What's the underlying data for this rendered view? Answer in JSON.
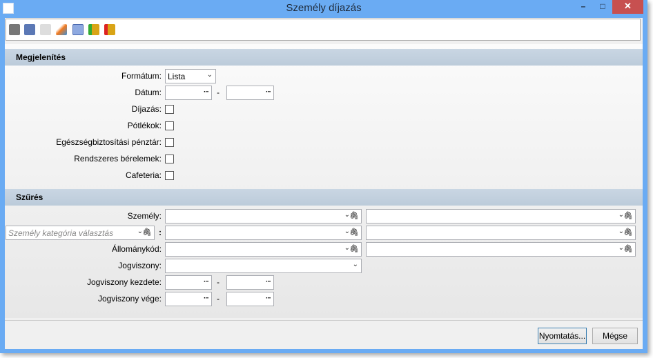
{
  "window": {
    "title": "Személy díjazás",
    "minimize": "–",
    "maximize": "□",
    "close": "✕"
  },
  "toolbar": [
    "print-icon",
    "preview-icon",
    "export-icon",
    "edit-icon",
    "calculator-icon",
    "db-import-icon",
    "db-export-icon"
  ],
  "display": {
    "header": "Megjelenítés",
    "format_label": "Formátum:",
    "format_value": "Lista",
    "date_label": "Dátum:",
    "dash": "-",
    "dots": "···",
    "checkboxes": [
      "Díjazás:",
      "Pótlékok:",
      "Egészségbiztosítási pénztár:",
      "Rendszeres bérelemek:",
      "Cafeteria:"
    ]
  },
  "filter": {
    "header": "Szűrés",
    "person_label": "Személy:",
    "category_placeholder": "Személy kategória választás",
    "colon": ":",
    "staff_label": "Állománykód:",
    "relation_label": "Jogviszony:",
    "relation_start_label": "Jogviszony kezdete:",
    "relation_end_label": "Jogviszony vége:"
  },
  "buttons": {
    "print": "Nyomtatás...",
    "cancel": "Mégse"
  },
  "colors": {
    "titlebar": "#6aabf3",
    "close": "#c75050",
    "section": "#c3d1df"
  }
}
